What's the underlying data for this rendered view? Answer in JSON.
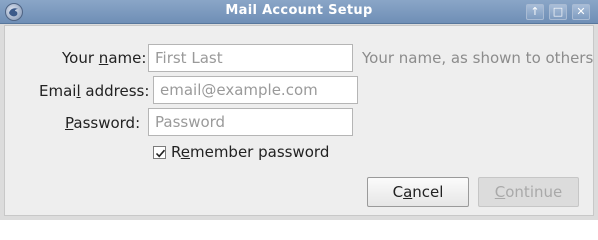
{
  "window": {
    "title": "Mail Account Setup",
    "icons": {
      "app": "thunderbird-icon",
      "up": "up-arrow-icon",
      "maximize": "maximize-icon",
      "close": "close-icon"
    },
    "glyphs": {
      "up": "↑",
      "maximize": "□",
      "close": "✕"
    }
  },
  "form": {
    "name": {
      "label_pre": "Your ",
      "label_key": "n",
      "label_post": "ame:",
      "placeholder": "First Last",
      "value": "",
      "hint": "Your name, as shown to others"
    },
    "email": {
      "label_pre": "Emai",
      "label_key": "l",
      "label_post": " address:",
      "placeholder": "email@example.com",
      "value": ""
    },
    "password": {
      "label_pre": "",
      "label_key": "P",
      "label_post": "assword:",
      "placeholder": "Password",
      "value": ""
    },
    "remember": {
      "label_pre": "R",
      "label_key": "e",
      "label_post": "member password",
      "checked": true
    }
  },
  "buttons": {
    "cancel": {
      "label_pre": "C",
      "label_key": "a",
      "label_post": "ncel"
    },
    "continue": {
      "label_pre": "",
      "label_key": "C",
      "label_post": "ontinue",
      "disabled": true
    }
  },
  "colors": {
    "titlebar": "#6f8fb6",
    "dialog_bg": "#eeeeee",
    "hint_text": "#8c8c8c",
    "disabled_text": "#a9a9a9"
  }
}
